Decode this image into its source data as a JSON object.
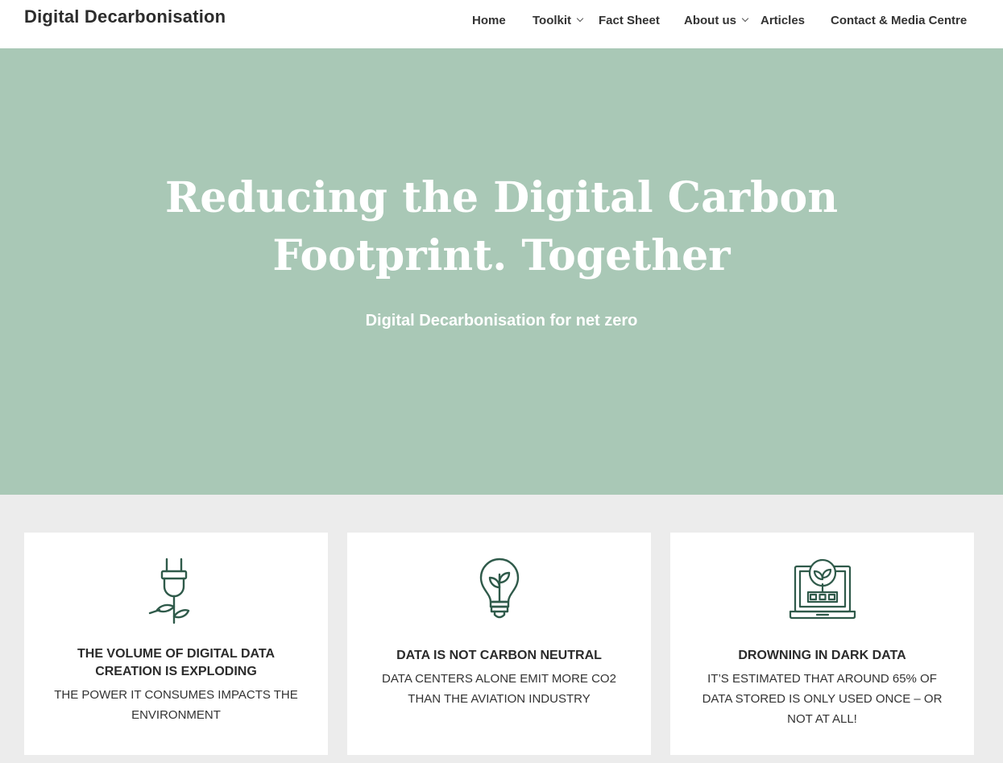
{
  "site": {
    "title": "Digital Decarbonisation"
  },
  "nav": {
    "items": [
      {
        "label": "Home"
      },
      {
        "label": "Toolkit",
        "has_dropdown": true
      },
      {
        "label": "Fact Sheet"
      },
      {
        "label": "About us",
        "has_dropdown": true
      },
      {
        "label": "Articles"
      },
      {
        "label": "Contact & Media Centre"
      }
    ]
  },
  "hero": {
    "title_line1": "Reducing the Digital Carbon",
    "title_line2": "Footprint. Together",
    "subtitle": "Digital Decarbonisation for net zero",
    "background": "#a9c8b6"
  },
  "cards": [
    {
      "icon": "plug-sprout-icon",
      "title_line1": "THE VOLUME OF DIGITAL DATA",
      "title_line2": "CREATION IS EXPLODING",
      "text_line1": "THE POWER IT CONSUMES IMPACTS THE",
      "text_line2": "ENVIRONMENT"
    },
    {
      "icon": "lightbulb-sprout-icon",
      "title_line1": "DATA IS NOT CARBON NEUTRAL",
      "text_line1": "DATA CENTERS ALONE EMIT MORE CO2",
      "text_line2": "THAN THE AVIATION INDUSTRY"
    },
    {
      "icon": "laptop-plant-icon",
      "title_line1": "DROWNING IN DARK DATA",
      "text_line1": "IT’S ESTIMATED THAT AROUND 65% OF",
      "text_line2": "DATA STORED IS ONLY USED ONCE – OR",
      "text_line3": "NOT AT ALL!"
    }
  ],
  "colors": {
    "icon_stroke": "#2f5a4a",
    "page_bg": "#ececec"
  }
}
